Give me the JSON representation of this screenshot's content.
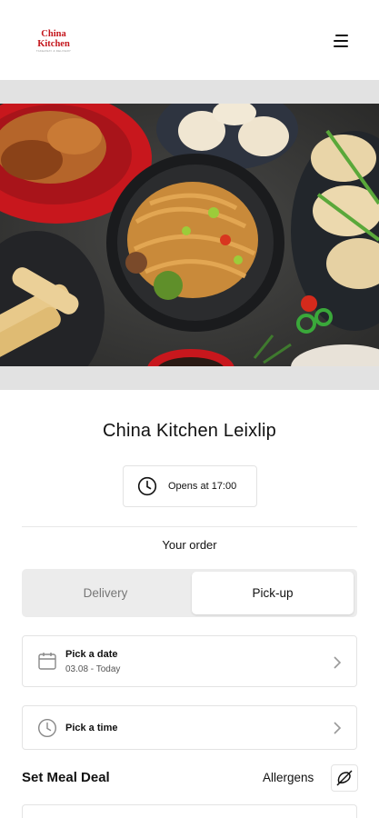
{
  "header": {
    "logo_line1": "China",
    "logo_line2": "Kitchen",
    "logo_tagline": "TAKEAWAY & DELIVERY",
    "menu_icon": "hamburger-menu-icon"
  },
  "restaurant": {
    "name": "China Kitchen Leixlip",
    "opens_text": "Opens at 17:00"
  },
  "order": {
    "heading": "Your order",
    "mode_options": [
      "Delivery",
      "Pick-up"
    ],
    "selected_mode": "Pick-up"
  },
  "pick_date": {
    "label": "Pick a date",
    "value": "03.08 - Today",
    "icon": "calendar-icon"
  },
  "pick_time": {
    "label": "Pick a time",
    "icon": "clock-icon"
  },
  "menu_section": {
    "title": "Set Meal Deal",
    "allergens_label": "Allergens",
    "allergens_icon": "allergen-filter-icon"
  },
  "colors": {
    "brand_red": "#c4161c",
    "band_grey": "#e2e2e2",
    "segment_bg": "#ececec"
  }
}
